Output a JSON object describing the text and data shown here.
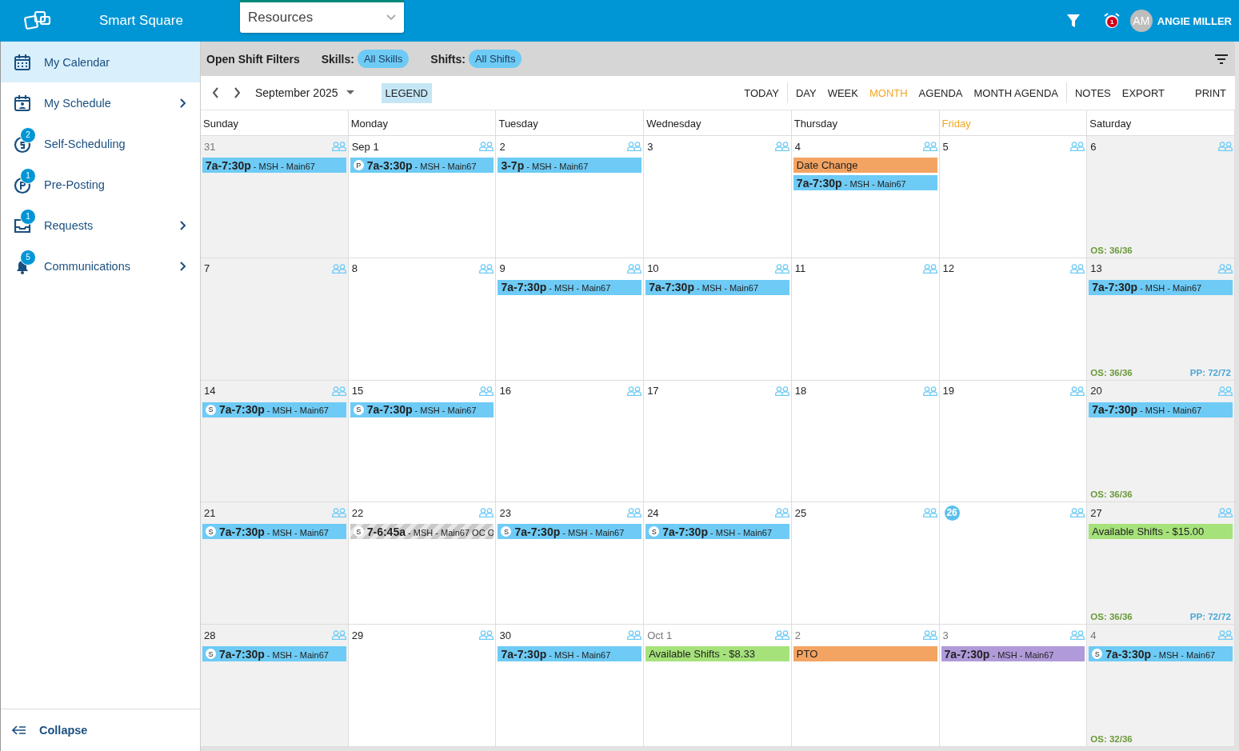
{
  "app": {
    "name": "Smart Square",
    "module_select": {
      "value": "Resources"
    },
    "alarm_badge": "1",
    "user": {
      "initials": "AM",
      "name": "ANGIE MILLER"
    }
  },
  "sidebar": {
    "items": [
      {
        "label": "My Calendar",
        "selected": true,
        "submenu": false
      },
      {
        "label": "My Schedule",
        "selected": false,
        "submenu": true
      },
      {
        "label": "Self-Scheduling",
        "selected": false,
        "submenu": false,
        "badge": "2"
      },
      {
        "label": "Pre-Posting",
        "selected": false,
        "submenu": false,
        "badge": "1"
      },
      {
        "label": "Requests",
        "selected": false,
        "submenu": true,
        "badge": "1"
      },
      {
        "label": "Communications",
        "selected": false,
        "submenu": true,
        "badge": "5"
      }
    ],
    "collapse": "Collapse"
  },
  "filters": {
    "title": "Open Shift Filters",
    "items": [
      {
        "label": "Skills:",
        "value": "All Skills"
      },
      {
        "label": "Shifts:",
        "value": "All Shifts"
      }
    ]
  },
  "toolbar": {
    "month": "September 2025",
    "legend": "LEGEND",
    "views": [
      {
        "label": "TODAY",
        "divider_before": false,
        "selected": false
      },
      {
        "label": "DAY",
        "divider_before": true,
        "selected": false
      },
      {
        "label": "WEEK",
        "divider_before": false,
        "selected": false
      },
      {
        "label": "MONTH",
        "divider_before": false,
        "selected": true
      },
      {
        "label": "AGENDA",
        "divider_before": false,
        "selected": false
      },
      {
        "label": "MONTH AGENDA",
        "divider_before": false,
        "selected": false
      },
      {
        "label": "NOTES",
        "divider_before": true,
        "selected": false
      },
      {
        "label": "EXPORT",
        "divider_before": false,
        "selected": false
      },
      {
        "label": "PRINT",
        "divider_before": false,
        "selected": false
      }
    ]
  },
  "calendar": {
    "columns": [
      {
        "label": "Sunday",
        "today": false,
        "weekend": true
      },
      {
        "label": "Monday",
        "today": false,
        "weekend": false
      },
      {
        "label": "Tuesday",
        "today": false,
        "weekend": false
      },
      {
        "label": "Wednesday",
        "today": false,
        "weekend": false
      },
      {
        "label": "Thursday",
        "today": false,
        "weekend": false
      },
      {
        "label": "Friday",
        "today": true,
        "weekend": false
      },
      {
        "label": "Saturday",
        "today": false,
        "weekend": true
      }
    ],
    "weeks": [
      {
        "days": [
          {
            "date": "31",
            "muted": true,
            "today": false,
            "events": [
              {
                "kind": "shift",
                "color": "#6ecbf5",
                "text": "**7a-7:30p** - MSH - Main67"
              }
            ]
          },
          {
            "date": "Sep 1",
            "muted": false,
            "today": false,
            "events": [
              {
                "kind": "shift",
                "color": "#6ecbf5",
                "badge": "P",
                "text": "**7a-3:30p** - MSH - Main67"
              }
            ]
          },
          {
            "date": "2",
            "muted": false,
            "today": false,
            "events": [
              {
                "kind": "shift",
                "color": "#6ecbf5",
                "text": "**3-7p** - MSH - Main67"
              }
            ]
          },
          {
            "date": "3",
            "muted": false,
            "today": false
          },
          {
            "date": "4",
            "muted": false,
            "today": false,
            "events": [
              {
                "kind": "label",
                "color": "#f4a462",
                "text": "Date Change"
              },
              {
                "kind": "shift",
                "color": "#6ecbf5",
                "text": "**7a-7:30p** - MSH - Main67"
              }
            ]
          },
          {
            "date": "5",
            "muted": false,
            "today": false
          },
          {
            "date": "6",
            "muted": false,
            "today": false,
            "os": "OS: 36/36"
          }
        ]
      },
      {
        "days": [
          {
            "date": "7",
            "muted": false,
            "today": false
          },
          {
            "date": "8",
            "muted": false,
            "today": false
          },
          {
            "date": "9",
            "muted": false,
            "today": false,
            "events": [
              {
                "kind": "shift",
                "color": "#6ecbf5",
                "text": "**7a-7:30p** - MSH - Main67"
              }
            ]
          },
          {
            "date": "10",
            "muted": false,
            "today": false,
            "events": [
              {
                "kind": "shift",
                "color": "#6ecbf5",
                "text": "**7a-7:30p** - MSH - Main67"
              }
            ]
          },
          {
            "date": "11",
            "muted": false,
            "today": false
          },
          {
            "date": "12",
            "muted": false,
            "today": false
          },
          {
            "date": "13",
            "muted": false,
            "today": false,
            "events": [
              {
                "kind": "shift",
                "color": "#6ecbf5",
                "text": "**7a-7:30p** - MSH - Main67"
              }
            ],
            "os": "OS: 36/36",
            "pp": "PP: 72/72"
          }
        ]
      },
      {
        "days": [
          {
            "date": "14",
            "muted": false,
            "today": false,
            "events": [
              {
                "kind": "shift",
                "color": "#6ecbf5",
                "badge": "S",
                "text": "**7a-7:30p** - MSH - Main67"
              }
            ]
          },
          {
            "date": "15",
            "muted": false,
            "today": false,
            "events": [
              {
                "kind": "shift",
                "color": "#6ecbf5",
                "badge": "S",
                "text": "**7a-7:30p** - MSH - Main67"
              }
            ]
          },
          {
            "date": "16",
            "muted": false,
            "today": false
          },
          {
            "date": "17",
            "muted": false,
            "today": false
          },
          {
            "date": "18",
            "muted": false,
            "today": false
          },
          {
            "date": "19",
            "muted": false,
            "today": false
          },
          {
            "date": "20",
            "muted": false,
            "today": false,
            "events": [
              {
                "kind": "shift",
                "color": "#6ecbf5",
                "text": "**7a-7:30p** - MSH - Main67"
              }
            ],
            "os": "OS: 36/36"
          }
        ]
      },
      {
        "days": [
          {
            "date": "21",
            "muted": false,
            "today": false,
            "events": [
              {
                "kind": "shift",
                "color": "#6ecbf5",
                "badge": "S",
                "text": "**7a-7:30p** - MSH - Main67"
              }
            ]
          },
          {
            "date": "22",
            "muted": false,
            "today": false,
            "events": [
              {
                "kind": "striped",
                "color": "#c8c8c8",
                "badge": "S",
                "text": "**7-6:45a** - MSH - Main67 OC O"
              }
            ]
          },
          {
            "date": "23",
            "muted": false,
            "today": false,
            "events": [
              {
                "kind": "shift",
                "color": "#6ecbf5",
                "badge": "S",
                "text": "**7a-7:30p** - MSH - Main67"
              }
            ]
          },
          {
            "date": "24",
            "muted": false,
            "today": false,
            "events": [
              {
                "kind": "shift",
                "color": "#6ecbf5",
                "badge": "S",
                "text": "**7a-7:30p** - MSH - Main67"
              }
            ]
          },
          {
            "date": "25",
            "muted": false,
            "today": false
          },
          {
            "date": "26",
            "muted": false,
            "today": true
          },
          {
            "date": "27",
            "muted": false,
            "today": false,
            "events": [
              {
                "kind": "label",
                "color": "#a6e27a",
                "text": "Available Shifts - $15.00"
              }
            ],
            "os": "OS: 36/36",
            "pp": "PP: 72/72"
          }
        ]
      },
      {
        "days": [
          {
            "date": "28",
            "muted": false,
            "today": false,
            "events": [
              {
                "kind": "shift",
                "color": "#6ecbf5",
                "badge": "S",
                "text": "**7a-7:30p** - MSH - Main67"
              }
            ]
          },
          {
            "date": "29",
            "muted": false,
            "today": false
          },
          {
            "date": "30",
            "muted": false,
            "today": false,
            "events": [
              {
                "kind": "shift",
                "color": "#6ecbf5",
                "text": "**7a-7:30p** - MSH - Main67"
              }
            ]
          },
          {
            "date": "Oct 1",
            "muted": true,
            "today": false,
            "events": [
              {
                "kind": "label",
                "color": "#a6e27a",
                "text": "Available Shifts - $8.33"
              }
            ]
          },
          {
            "date": "2",
            "muted": true,
            "today": false,
            "events": [
              {
                "kind": "label",
                "color": "#f4a462",
                "text": "PTO"
              }
            ]
          },
          {
            "date": "3",
            "muted": true,
            "today": false,
            "events": [
              {
                "kind": "shift",
                "color": "#b09ad9",
                "text": "**7a-7:30p** - MSH - Main67"
              }
            ]
          },
          {
            "date": "4",
            "muted": true,
            "today": false,
            "events": [
              {
                "kind": "shift",
                "color": "#6ecbf5",
                "badge": "S",
                "text": "**7a-3:30p** - MSH - Main67"
              }
            ],
            "os": "OS: 32/36"
          }
        ]
      }
    ]
  }
}
